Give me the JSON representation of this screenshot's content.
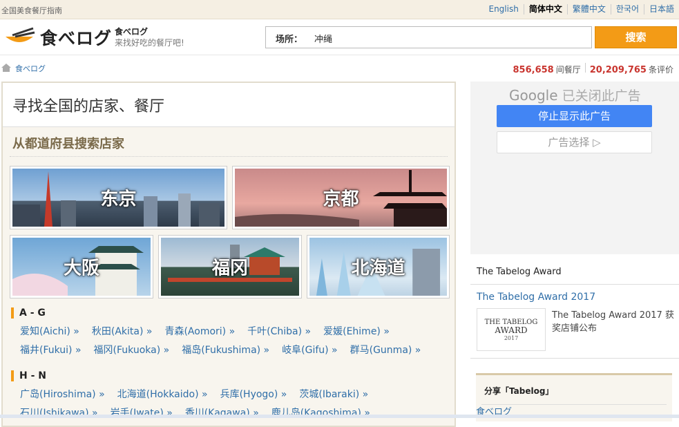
{
  "topbar": {
    "tagline": "全国美食餐厅指南",
    "languages": [
      {
        "label": "English",
        "current": false
      },
      {
        "label": "简体中文",
        "current": true
      },
      {
        "label": "繁體中文",
        "current": false
      },
      {
        "label": "한국어",
        "current": false
      },
      {
        "label": "日本語",
        "current": false
      }
    ]
  },
  "header": {
    "logo_text": "食べログ",
    "slogan_title": "食べログ",
    "slogan_sub": "来找好吃的餐厅吧!",
    "search_label": "场所：",
    "search_value": "冲绳",
    "search_button": "搜索"
  },
  "breadcrumb": {
    "home": "食べログ"
  },
  "stats": {
    "restaurants": "856,658",
    "restaurants_unit": "间餐厅",
    "reviews": "20,209,765",
    "reviews_unit": "条评价"
  },
  "main": {
    "title": "寻找全国的店家、餐厅",
    "subtitle": "从都道府县搜索店家",
    "cities": [
      "东京",
      "京都",
      "大阪",
      "福冈",
      "北海道"
    ],
    "groups": [
      {
        "label": "A - G",
        "prefs": [
          "爱知(Aichi) »",
          "秋田(Akita) »",
          "青森(Aomori) »",
          "千叶(Chiba) »",
          "爱媛(Ehime) »",
          "福井(Fukui) »",
          "福冈(Fukuoka) »",
          "福岛(Fukushima) »",
          "岐阜(Gifu) »",
          "群马(Gunma) »"
        ]
      },
      {
        "label": "H - N",
        "prefs": [
          "广岛(Hiroshima) »",
          "北海道(Hokkaido) »",
          "兵库(Hyogo) »",
          "茨城(Ibaraki) »",
          "石川(Ishikawa) »",
          "岩手(Iwate) »",
          "香川(Kagawa) »",
          "鹿儿岛(Kagoshima) »"
        ]
      }
    ]
  },
  "ad": {
    "google": "Google",
    "closed": "已关闭此广告",
    "stop": "停止显示此广告",
    "choice": "广告选择"
  },
  "award": {
    "heading": "The Tabelog Award",
    "link": "The Tabelog Award 2017",
    "img_line1": "THE TABELOG",
    "img_line2": "AWARD",
    "img_year": "2017",
    "desc": "The Tabelog Award 2017 获奖店铺公布"
  },
  "share": {
    "title": "分享「Tabelog」",
    "link": "食べログ"
  }
}
